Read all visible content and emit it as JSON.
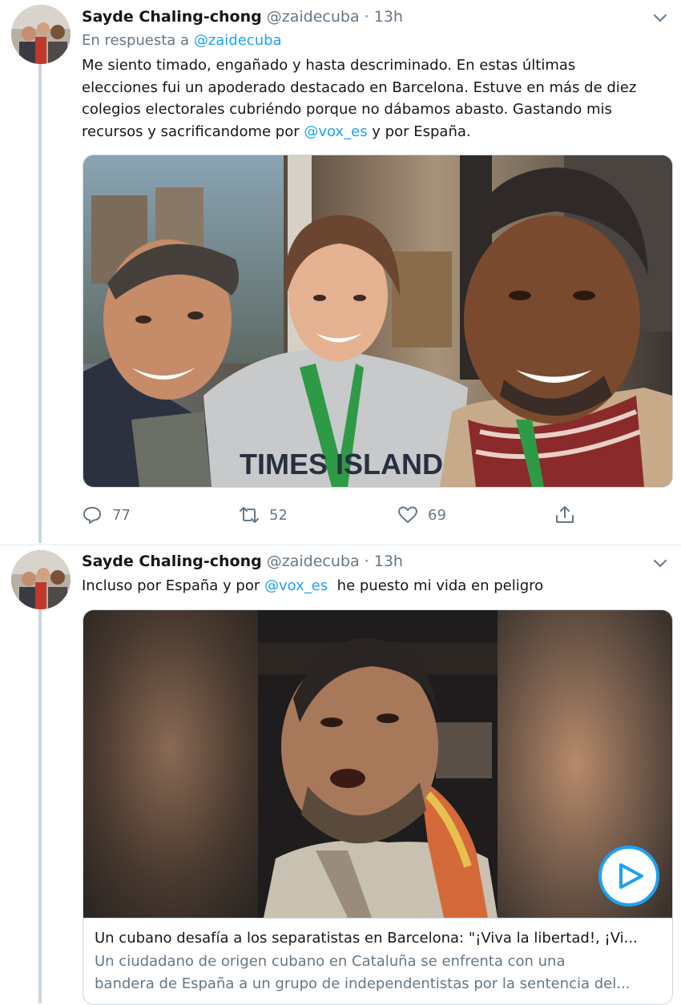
{
  "tweets": [
    {
      "name": "Sayde Chaling-chong",
      "handle": "@zaidecuba",
      "separator": "·",
      "time": "13h",
      "reply_prefix": "En respuesta a",
      "reply_mention": "@zaidecuba",
      "text_lines": [
        "Me siento timado, engañado y hasta descriminado. En estas últimas",
        "elecciones fui un apoderado destacado en Barcelona.  Estuve en más de diez",
        "colegios electorales cubriéndo porque no dábamos abasto. Gastando mis"
      ],
      "text_last_pre": "recursos y sacrificandome por ",
      "text_last_mention": "@vox_es",
      "text_last_post": " y por España.",
      "stats": {
        "replies": "77",
        "retweets": "52",
        "likes": "69"
      }
    },
    {
      "name": "Sayde Chaling-chong",
      "handle": "@zaidecuba",
      "separator": "·",
      "time": "13h",
      "text_pre": "Incluso por España y por ",
      "text_mention": "@vox_es",
      "text_post": "  he puesto mi vida en peligro",
      "card": {
        "title": "Un cubano desafía a los separatistas en Barcelona: \"¡Viva la libertad!, ¡Vi...",
        "description_lines": [
          "Un ciudadano de origen cubano en Cataluña se enfrenta con una",
          "bandera de España a un grupo de independentistas por la sentencia del..."
        ]
      }
    }
  ],
  "colors": {
    "accent": "#1da1f2",
    "secondary_text": "#657786",
    "border": "#ccd6dd"
  },
  "icons": [
    "chevron-down-icon",
    "reply-icon",
    "retweet-icon",
    "like-icon",
    "share-icon",
    "play-icon"
  ]
}
